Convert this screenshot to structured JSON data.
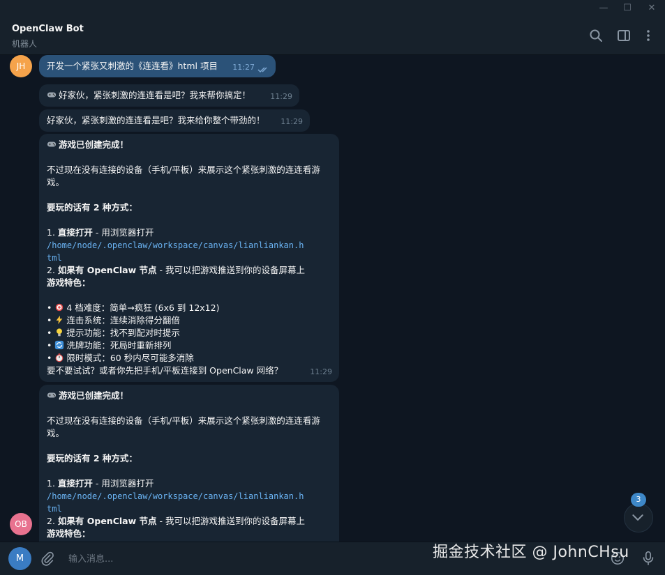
{
  "window": {
    "minimize": "—",
    "maximize": "☐",
    "close": "✕"
  },
  "header": {
    "title": "OpenClaw Bot",
    "subtitle": "机器人"
  },
  "avatars": {
    "user": "JH",
    "bot": "OB",
    "composer": "M"
  },
  "colors": {
    "user_avatar": "#f5a34b",
    "bot_avatar": "#e8728f",
    "composer_avatar": "#3a7cc3"
  },
  "messages": {
    "m1": {
      "text": "开发一个紧张又刺激的《连连看》html 项目",
      "time": "11:27"
    },
    "m2": {
      "text": "好家伙，紧张刺激的连连看是吧？我来帮你搞定！",
      "time": "11:29"
    },
    "m3": {
      "text": "好家伙，紧张刺激的连连看是吧？我来给你整个带劲的！",
      "time": "11:29"
    },
    "m4": {
      "title": "游戏已创建完成！",
      "intro1": "不过现在没有连接的设备（手机/平板）来展示这个紧张刺激的连连看游",
      "intro2": "戏。",
      "ways_title": "要玩的话有 2 种方式：",
      "way1_num": "1. ",
      "way1_bold": "直接打开",
      "way1_rest": " - 用浏览器打开",
      "path1": "/home/node/.openclaw/workspace/canvas/lianliankan.h",
      "path2": "tml",
      "way2_num": "2. ",
      "way2_bold": "如果有 OpenClaw 节点",
      "way2_rest": " - 我可以把游戏推送到你的设备屏幕上",
      "features_title": "游戏特色：",
      "f1": "4 档难度：简单→疯狂 (6x6 到 12x12)",
      "f2": "连击系统：连续消除得分翻倍",
      "f3": "提示功能：找不到配对时提示",
      "f4": "洗牌功能：死局时重新排列",
      "f5": "限时模式：60 秒内尽可能多消除",
      "closing": "要不要试试？或者你先把手机/平板连接到 OpenClaw 网络？",
      "time": "11:29"
    },
    "m5": {
      "title": "游戏已创建完成！",
      "intro1": "不过现在没有连接的设备（手机/平板）来展示这个紧张刺激的连连看游",
      "intro2": "戏。",
      "ways_title": "要玩的话有 2 种方式：",
      "way1_num": "1. ",
      "way1_bold": "直接打开",
      "way1_rest": " - 用浏览器打开",
      "path1": "/home/node/.openclaw/workspace/canvas/lianliankan.h",
      "path2": "tml",
      "way2_num": "2. ",
      "way2_bold": "如果有 OpenClaw 节点",
      "way2_rest": " - 我可以把游戏推送到你的设备屏幕上",
      "features_title": "游戏特色："
    }
  },
  "scroll": {
    "unread": "3"
  },
  "composer": {
    "placeholder": "输入消息..."
  },
  "watermark": "掘金技术社区 @ JohnCHsu"
}
